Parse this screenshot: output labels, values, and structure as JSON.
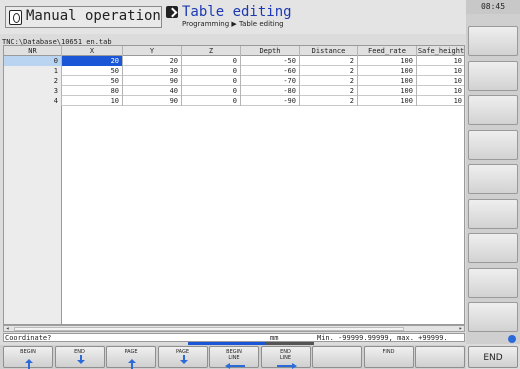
{
  "header": {
    "mode_title": "Manual operation",
    "program_title": "Table editing",
    "program_crumb": "Programming ▶ Table editing",
    "clock": "08:45"
  },
  "table": {
    "path": "TNC:\\Database\\10651_en.tab",
    "columns": [
      "NR",
      "X",
      "Y",
      "Z",
      "Depth",
      "Distance",
      "Feed_rate",
      "Safe_height"
    ],
    "rows": [
      [
        "0",
        "20",
        "20",
        "0",
        "-50",
        "2",
        "100",
        "10"
      ],
      [
        "1",
        "50",
        "30",
        "0",
        "-60",
        "2",
        "100",
        "10"
      ],
      [
        "2",
        "50",
        "90",
        "0",
        "-70",
        "2",
        "100",
        "10"
      ],
      [
        "3",
        "80",
        "40",
        "0",
        "-80",
        "2",
        "100",
        "10"
      ],
      [
        "4",
        "10",
        "90",
        "0",
        "-90",
        "2",
        "100",
        "10"
      ]
    ],
    "active_row": 0,
    "active_col": 1
  },
  "status": {
    "prompt": "Coordinate?",
    "unit": "mm",
    "range": "Min. -99999.99999, max. +99999."
  },
  "softkeys": [
    {
      "label": "BEGIN",
      "icon": "arrow-up-icon"
    },
    {
      "label": "END",
      "icon": "arrow-down-icon"
    },
    {
      "label": "PAGE",
      "icon": "arrow-up-icon"
    },
    {
      "label": "PAGE",
      "icon": "arrow-down-icon"
    },
    {
      "label": "BEGIN\nLINE",
      "icon": "arrow-left-icon"
    },
    {
      "label": "END\nLINE",
      "icon": "arrow-right-icon"
    },
    {
      "label": "",
      "icon": ""
    },
    {
      "label": "FIND",
      "icon": ""
    },
    {
      "label": "",
      "icon": ""
    }
  ],
  "end_key": "END"
}
